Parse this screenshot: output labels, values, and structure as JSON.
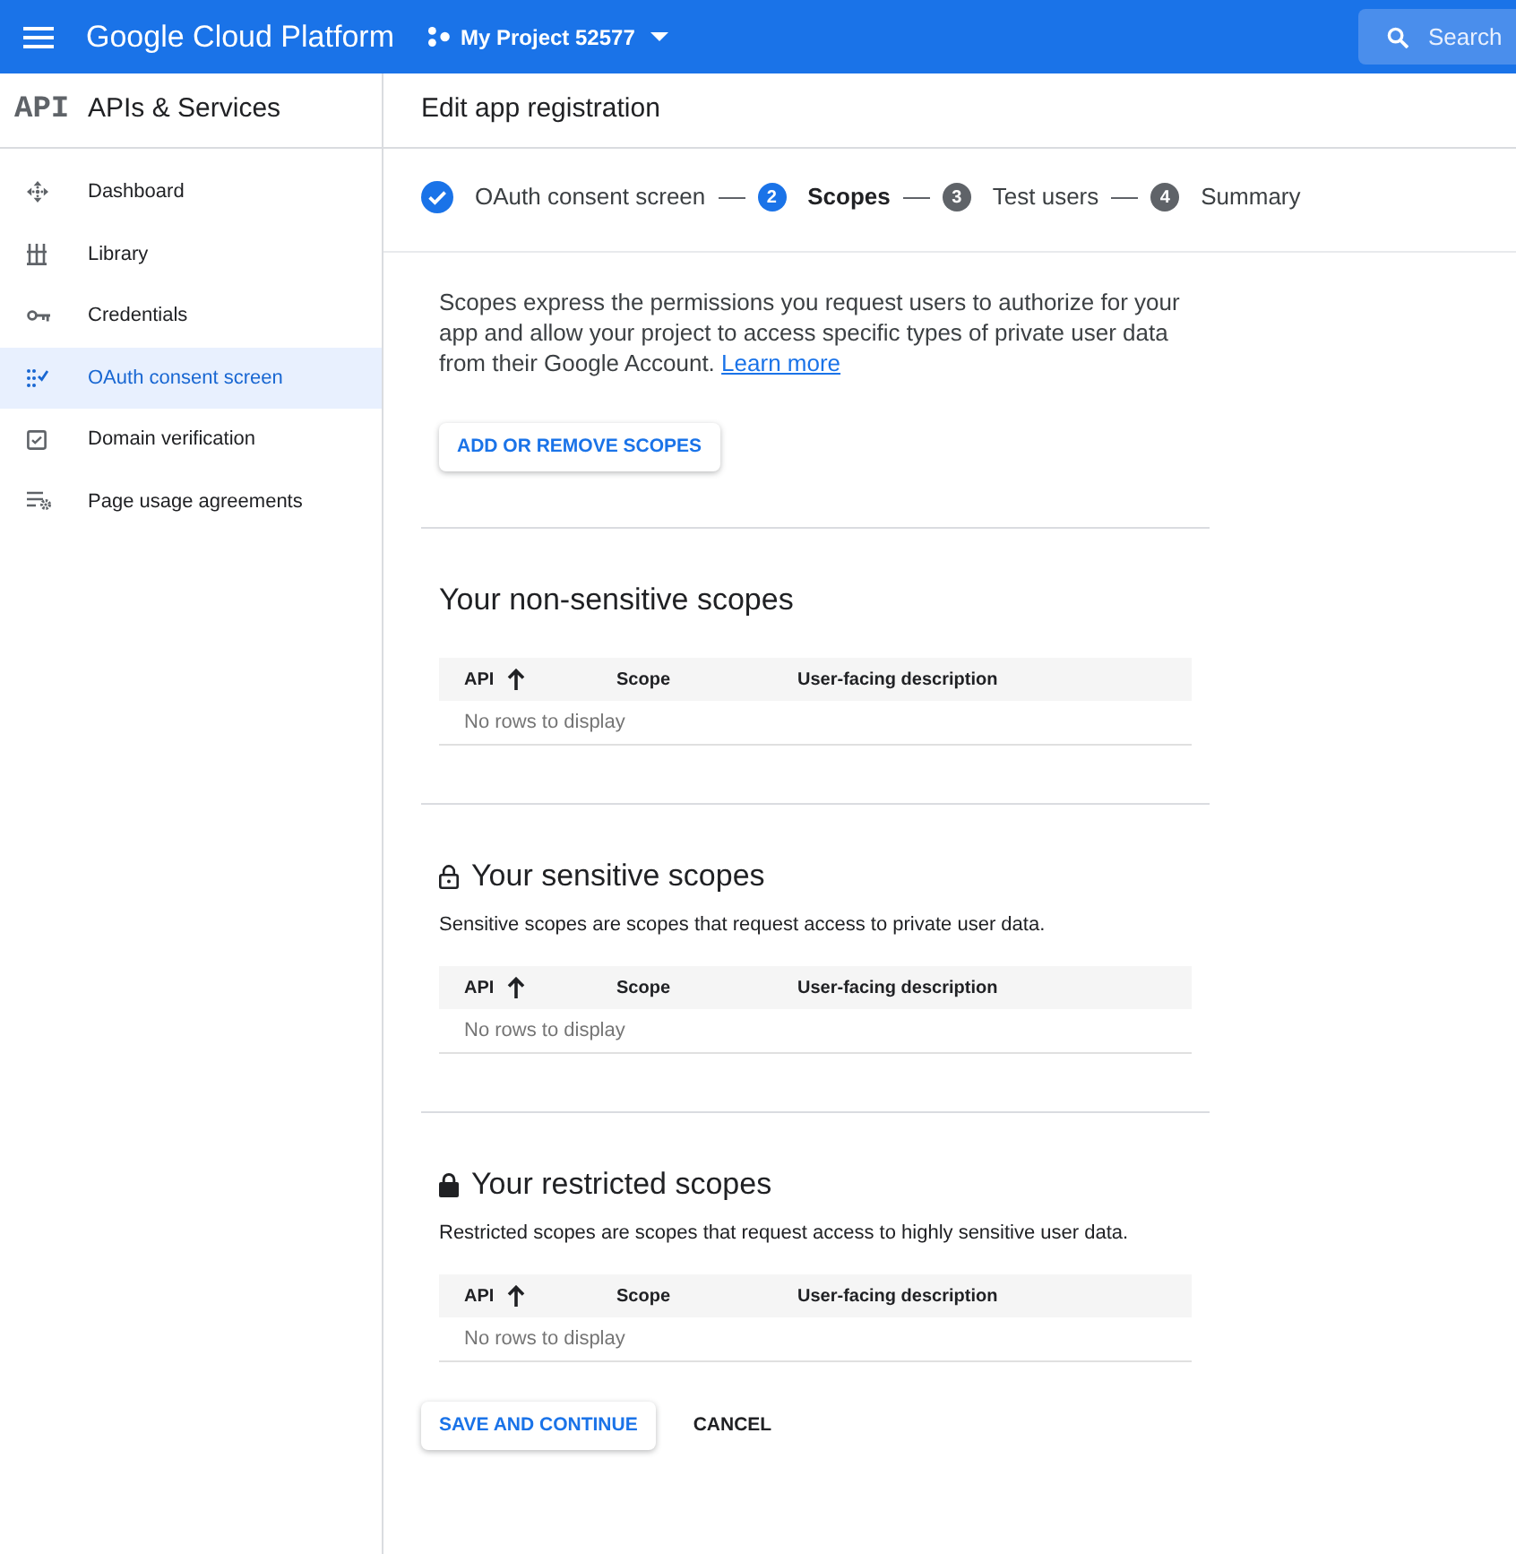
{
  "top_bar": {
    "title": "Google Cloud Platform",
    "project": "My Project 52577",
    "search": {
      "placeholder": "Search"
    }
  },
  "sidebar": {
    "logo": "API",
    "title": "APIs & Services",
    "items": [
      {
        "label": "Dashboard",
        "selected": false
      },
      {
        "label": "Library",
        "selected": false
      },
      {
        "label": "Credentials",
        "selected": false
      },
      {
        "label": "OAuth consent screen",
        "selected": true
      },
      {
        "label": "Domain verification",
        "selected": false
      },
      {
        "label": "Page usage agreements",
        "selected": false
      }
    ]
  },
  "page_title": "Edit app registration",
  "stepper": [
    {
      "label": "OAuth consent screen",
      "completed": true,
      "selected": false
    },
    {
      "number": "2",
      "label": "Scopes",
      "completed": false,
      "selected": true
    },
    {
      "number": "3",
      "label": "Test users",
      "completed": false,
      "selected": false
    },
    {
      "number": "4",
      "label": "Summary",
      "completed": false,
      "selected": false
    }
  ],
  "intro": {
    "text": "Scopes express the permissions you request users to authorize for your app and allow your project to access specific types of private user data from their Google Account.",
    "link": "Learn more"
  },
  "add_button": "ADD OR REMOVE SCOPES",
  "sections": [
    {
      "kind": "plain",
      "title": "Your non-sensitive scopes",
      "table": {
        "columns": [
          {
            "label": "API",
            "sorted": true
          },
          {
            "label": "Scope",
            "sorted": false
          },
          {
            "label": "User-facing description",
            "sorted": false
          }
        ],
        "empty_text": "No rows to display"
      }
    },
    {
      "kind": "sensitive",
      "title": "Your sensitive scopes",
      "description": "Sensitive scopes are scopes that request access to private user data.",
      "table": {
        "columns": [
          {
            "label": "API",
            "sorted": true
          },
          {
            "label": "Scope",
            "sorted": false
          },
          {
            "label": "User-facing description",
            "sorted": false
          }
        ],
        "empty_text": "No rows to display"
      }
    },
    {
      "kind": "restricted",
      "title": "Your restricted scopes",
      "description": "Restricted scopes are scopes that request access to highly sensitive user data.",
      "table": {
        "columns": [
          {
            "label": "API",
            "sorted": true
          },
          {
            "label": "Scope",
            "sorted": false
          },
          {
            "label": "User-facing description",
            "sorted": false
          }
        ],
        "empty_text": "No rows to display"
      }
    }
  ],
  "actions": [
    {
      "label": "SAVE AND CONTINUE",
      "kind": "raised"
    },
    {
      "label": "CANCEL",
      "kind": "flat"
    }
  ]
}
